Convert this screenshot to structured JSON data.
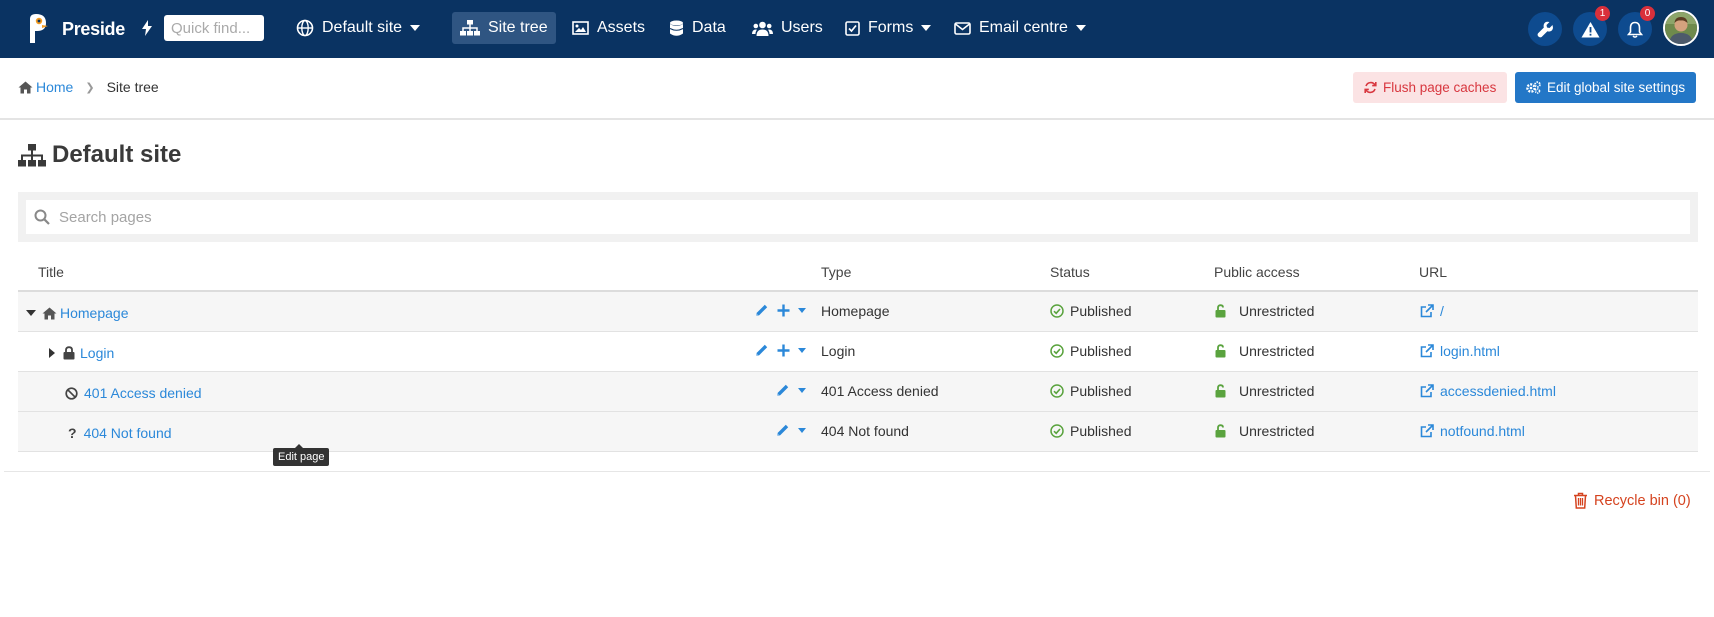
{
  "navbar": {
    "brand": "Preside",
    "quick_find_placeholder": "Quick find...",
    "site_selector": "Default site",
    "items": [
      {
        "label": "Site tree",
        "icon": "sitemap-icon",
        "active": true
      },
      {
        "label": "Assets",
        "icon": "image-icon"
      },
      {
        "label": "Data",
        "icon": "database-icon"
      },
      {
        "label": "Users",
        "icon": "users-icon"
      },
      {
        "label": "Forms",
        "icon": "check-square-icon",
        "dropdown": true
      },
      {
        "label": "Email centre",
        "icon": "envelope-icon",
        "dropdown": true
      }
    ],
    "alerts_count": "1",
    "notifications_count": "0"
  },
  "breadcrumb": {
    "home": "Home",
    "current": "Site tree"
  },
  "actions": {
    "flush": "Flush page caches",
    "global": "Edit global site settings"
  },
  "page": {
    "title": "Default site"
  },
  "search": {
    "placeholder": "Search pages"
  },
  "table": {
    "headers": {
      "title": "Title",
      "type": "Type",
      "status": "Status",
      "access": "Public access",
      "url": "URL"
    },
    "rows": [
      {
        "title": "Homepage",
        "type": "Homepage",
        "status": "Published",
        "access": "Unrestricted",
        "url": "/"
      },
      {
        "title": "Login",
        "type": "Login",
        "status": "Published",
        "access": "Unrestricted",
        "url": "login.html"
      },
      {
        "title": "401 Access denied",
        "type": "401 Access denied",
        "status": "Published",
        "access": "Unrestricted",
        "url": "accessdenied.html"
      },
      {
        "title": "404 Not found",
        "type": "404 Not found",
        "status": "Published",
        "access": "Unrestricted",
        "url": "notfound.html"
      }
    ]
  },
  "tooltip": "Edit page",
  "recycle_bin": "Recycle bin (0)",
  "colors": {
    "navbar": "#0a3362",
    "link": "#2b88d9",
    "primary_button": "#2377c7",
    "danger": "#d8373f",
    "success": "#5aa33e"
  }
}
